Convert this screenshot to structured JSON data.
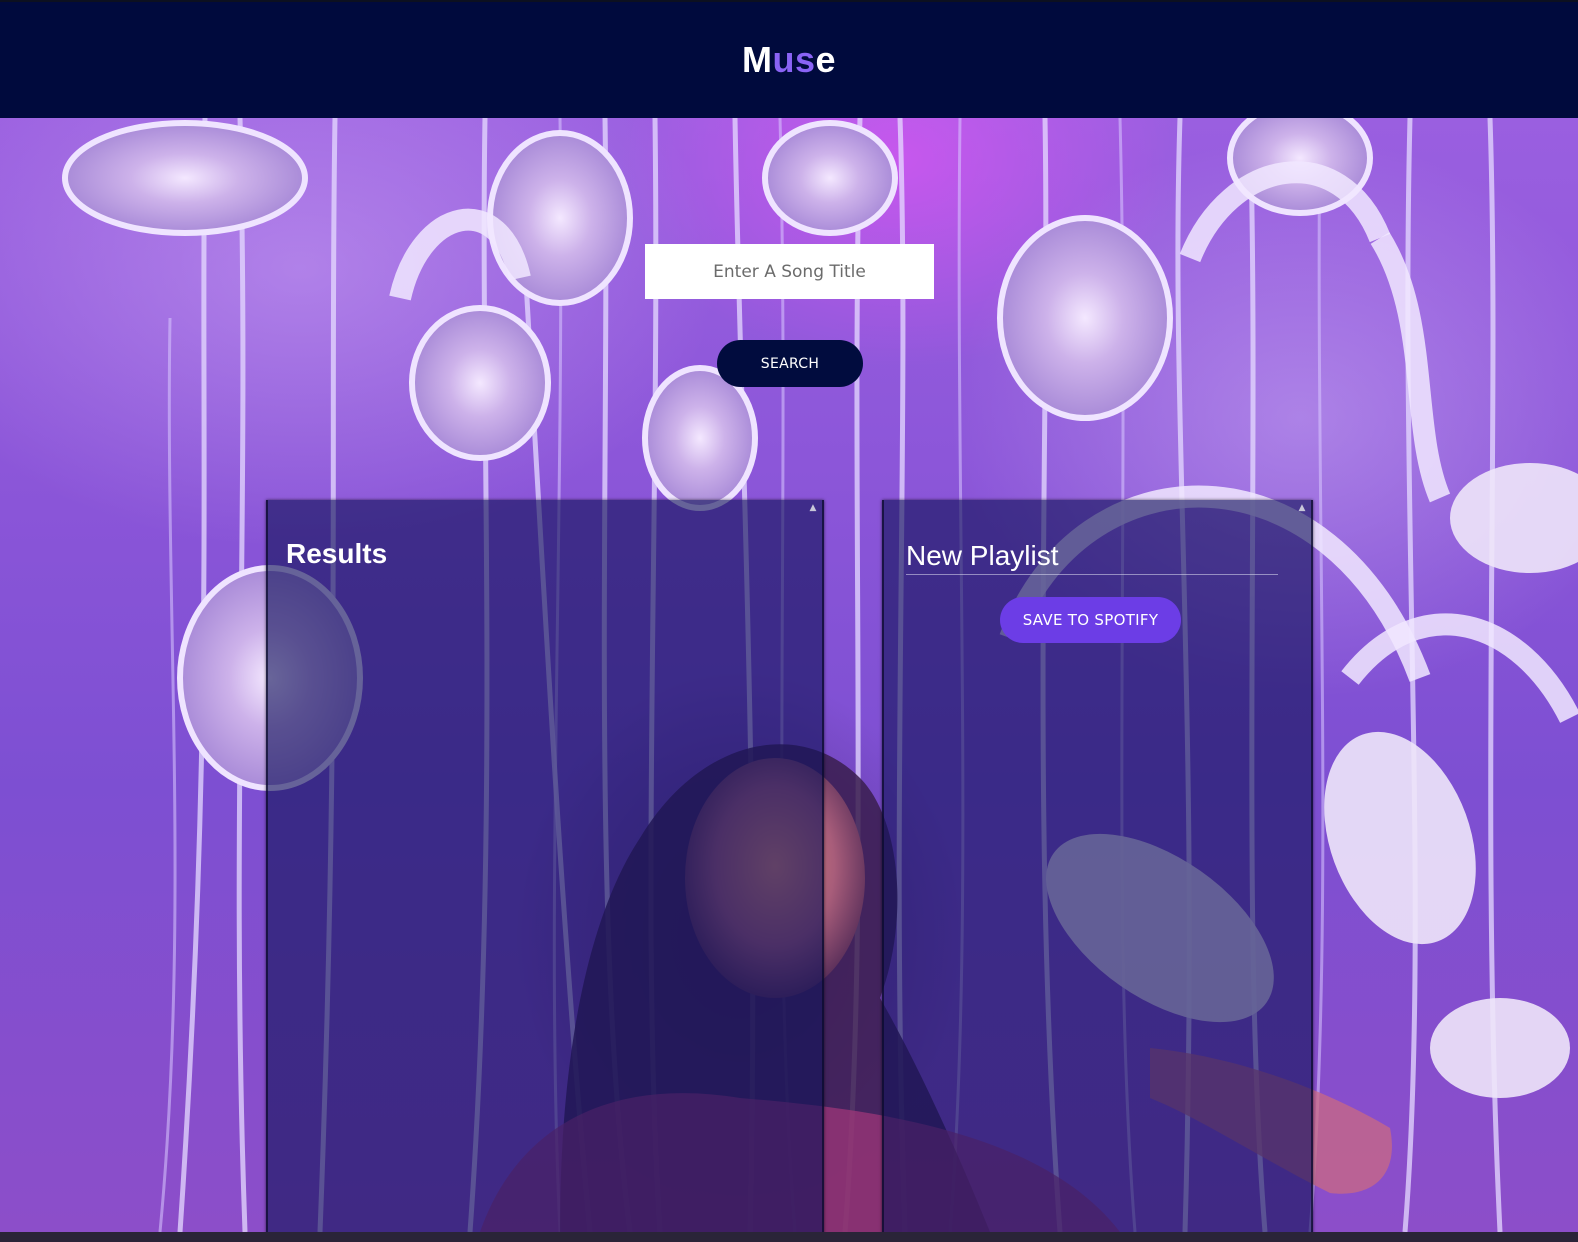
{
  "header": {
    "logo_parts": [
      "M",
      "us",
      "e"
    ]
  },
  "search": {
    "placeholder": "Enter A Song Title",
    "value": "",
    "button_label": "SEARCH"
  },
  "results": {
    "title": "Results",
    "tracks": []
  },
  "playlist": {
    "name": "New Playlist",
    "save_label": "SAVE TO SPOTIFY",
    "tracks": []
  },
  "colors": {
    "header_bg": "#000a3d",
    "accent": "#8a63f5",
    "search_button_bg": "#010c3e",
    "save_button_bg": "#6c3de6"
  }
}
